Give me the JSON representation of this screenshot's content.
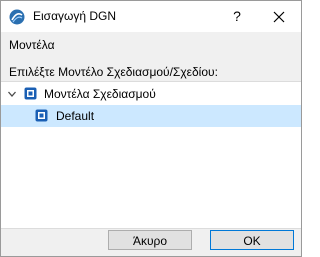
{
  "window": {
    "title": "Εισαγωγή DGN",
    "help_label": "?"
  },
  "labels": {
    "models_heading": "Μοντέλα",
    "select_prompt": "Επιλέξτε Μοντέλο Σχεδιασμού/Σχεδίου:"
  },
  "tree": {
    "root": {
      "label": "Μοντέλα Σχεδιασμού",
      "expanded": true,
      "icon": "model-icon"
    },
    "children": [
      {
        "label": "Default",
        "selected": true,
        "icon": "model-icon"
      }
    ]
  },
  "buttons": {
    "cancel": "Άκυρο",
    "ok": "OK"
  },
  "colors": {
    "selection": "#cce8ff",
    "icon_blue": "#1a5fb4",
    "ok_border": "#0078d7"
  }
}
